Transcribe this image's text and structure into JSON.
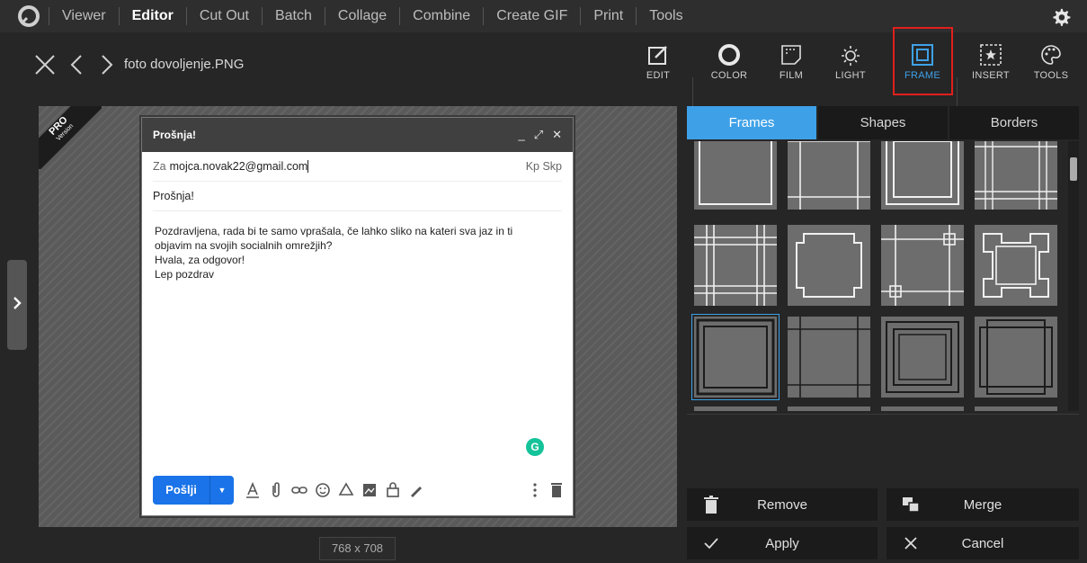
{
  "menu": {
    "items": [
      "Viewer",
      "Editor",
      "Cut Out",
      "Batch",
      "Collage",
      "Combine",
      "Create GIF",
      "Print",
      "Tools"
    ],
    "active_index": 1
  },
  "toolbar": {
    "filename": "foto dovoljenje.PNG",
    "tools": [
      "EDIT",
      "COLOR",
      "FILM",
      "LIGHT",
      "FRAME",
      "INSERT",
      "TOOLS"
    ],
    "selected": "FRAME"
  },
  "badge": {
    "pro": "PRO",
    "version": "Version"
  },
  "email": {
    "title": "Prošnja!",
    "window_controls": [
      "_",
      "⤢",
      "✕"
    ],
    "to_label": "Za",
    "to_value": "mojca.novak22@gmail.com",
    "cc_bcc": "Kp Skp",
    "subject": "Prošnja!",
    "body": [
      "Pozdravljena, rada bi te samo vprašala, če lahko sliko na kateri sva jaz in ti",
      "objavim na svojih socialnih omrežjih?",
      "Hvala, za odgovor!",
      "Lep pozdrav"
    ],
    "send_label": "Pošlji",
    "grammarly": "G"
  },
  "canvas": {
    "dimensions": "768 x 708"
  },
  "panel": {
    "tabs": [
      "Frames",
      "Shapes",
      "Borders"
    ],
    "active_tab": "Frames",
    "selected_frame_index": 8,
    "remove_label": "Remove",
    "merge_label": "Merge",
    "apply_label": "Apply",
    "cancel_label": "Cancel"
  },
  "colors": {
    "accent": "#3ea1e8",
    "highlight": "#e0201c",
    "send": "#1a73e8",
    "grammarly": "#15c39a"
  }
}
